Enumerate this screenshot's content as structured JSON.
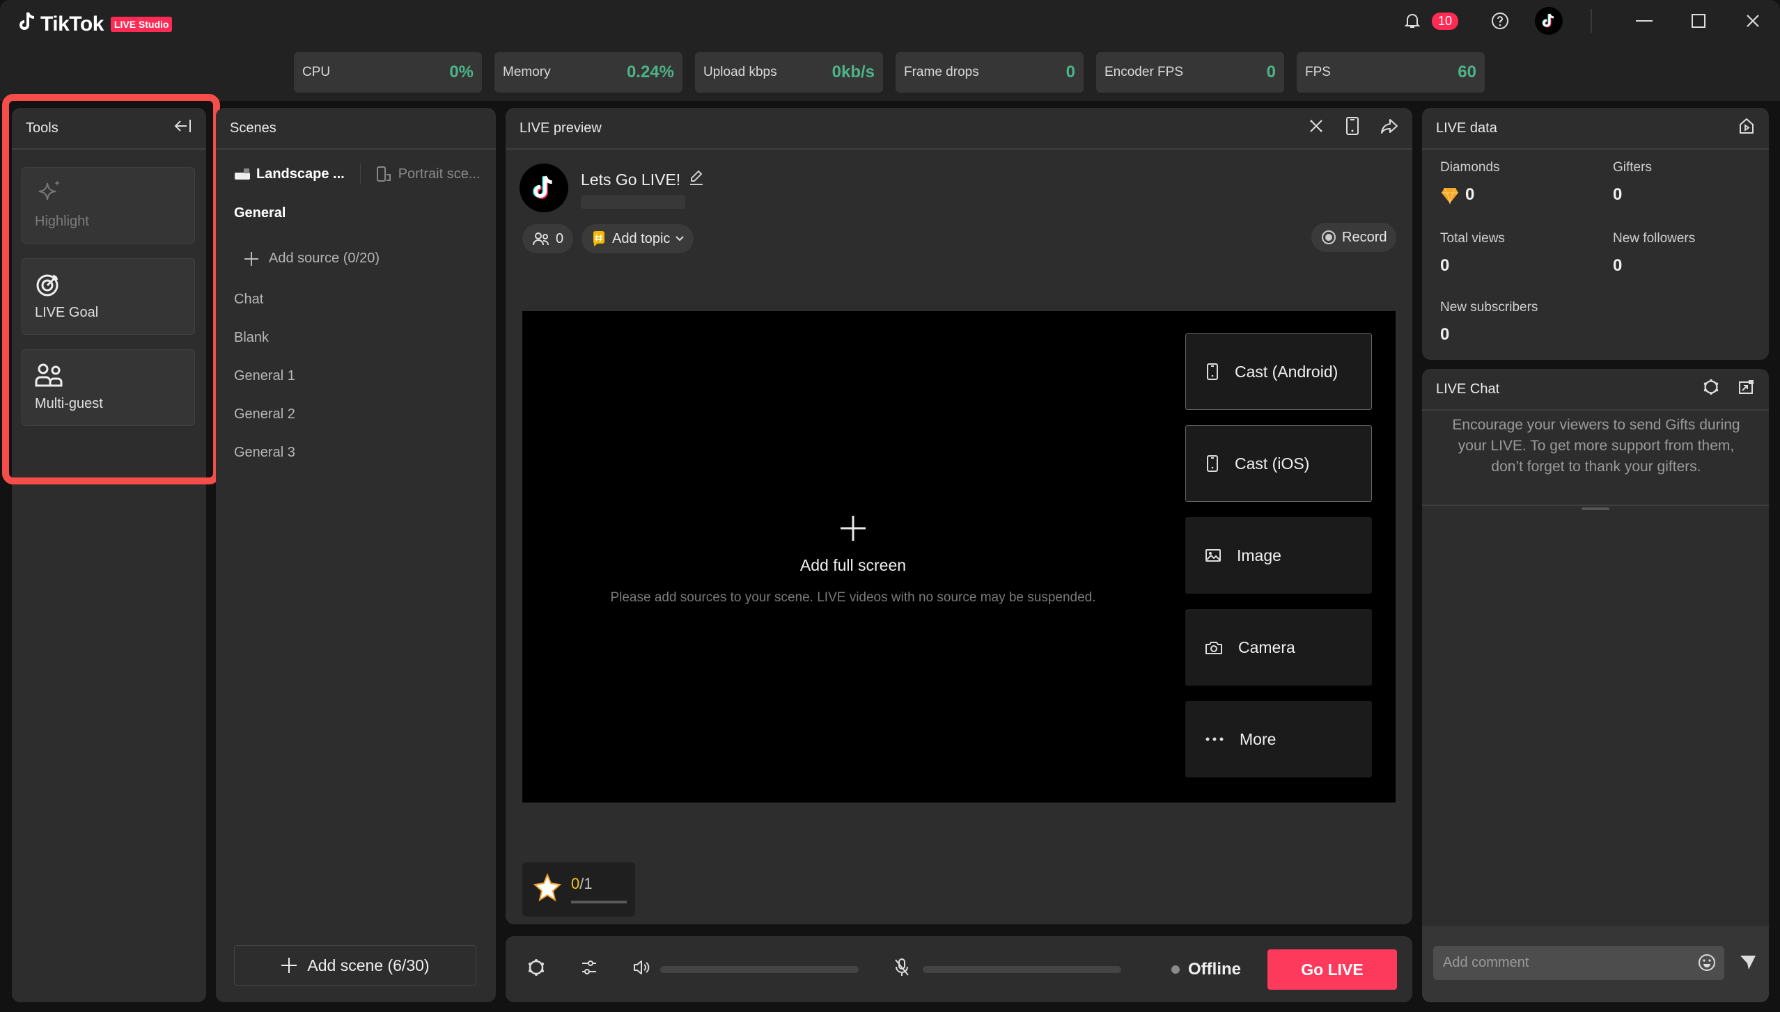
{
  "app": {
    "brand": "TikTok",
    "badge": "LIVE Studio",
    "notification_count": "10"
  },
  "stats": [
    {
      "label": "CPU",
      "value": "0%"
    },
    {
      "label": "Memory",
      "value": "0.24%"
    },
    {
      "label": "Upload kbps",
      "value": "0kb/s"
    },
    {
      "label": "Frame drops",
      "value": "0"
    },
    {
      "label": "Encoder FPS",
      "value": "0"
    },
    {
      "label": "FPS",
      "value": "60"
    }
  ],
  "tools": {
    "title": "Tools",
    "items": [
      {
        "label": "Highlight",
        "icon": "sparkle-icon",
        "disabled": true
      },
      {
        "label": "LIVE Goal",
        "icon": "target-icon",
        "disabled": false
      },
      {
        "label": "Multi-guest",
        "icon": "users-icon",
        "disabled": false
      }
    ]
  },
  "scenes": {
    "title": "Scenes",
    "tabs": [
      {
        "label": "Landscape ...",
        "active": true
      },
      {
        "label": "Portrait sce...",
        "active": false
      }
    ],
    "active_scene": "General",
    "add_source": "Add source (0/20)",
    "items": [
      "Chat",
      "Blank",
      "General 1",
      "General 2",
      "General 3"
    ],
    "add_scene": "Add scene (6/30)"
  },
  "preview": {
    "title": "LIVE preview",
    "stream_title": "Lets Go LIVE!",
    "viewers": "0",
    "add_topic": "Add topic",
    "record": "Record",
    "add_full_screen": "Add full screen",
    "hint": "Please add sources to your scene. LIVE videos with no source may be suspended.",
    "sources": [
      {
        "label": "Cast (Android)",
        "icon": "phone-icon"
      },
      {
        "label": "Cast (iOS)",
        "icon": "phone-icon"
      },
      {
        "label": "Image",
        "icon": "image-icon"
      },
      {
        "label": "Camera",
        "icon": "camera-icon"
      },
      {
        "label": "More",
        "icon": "more-icon"
      }
    ],
    "goal": {
      "current": "0",
      "total": "/1",
      "progress": 0
    }
  },
  "controls": {
    "speaker_level": 0,
    "mic_level": 0,
    "status": "Offline",
    "go_live": "Go LIVE"
  },
  "live_data": {
    "title": "LIVE data",
    "metrics": [
      {
        "label": "Diamonds",
        "value": "0"
      },
      {
        "label": "Gifters",
        "value": "0"
      },
      {
        "label": "Total views",
        "value": "0"
      },
      {
        "label": "New followers",
        "value": "0"
      },
      {
        "label": "New subscribers",
        "value": "0"
      }
    ]
  },
  "live_chat": {
    "title": "LIVE Chat",
    "tip": "Encourage your viewers to send Gifts during your LIVE. To get more support from them, don’t forget to thank your gifters.",
    "comment_placeholder": "Add comment"
  },
  "colors": {
    "accent": "#fe2c55",
    "stat_value": "#4db389",
    "highlight_box": "#f44d4a",
    "goal_current": "#f5c518"
  }
}
